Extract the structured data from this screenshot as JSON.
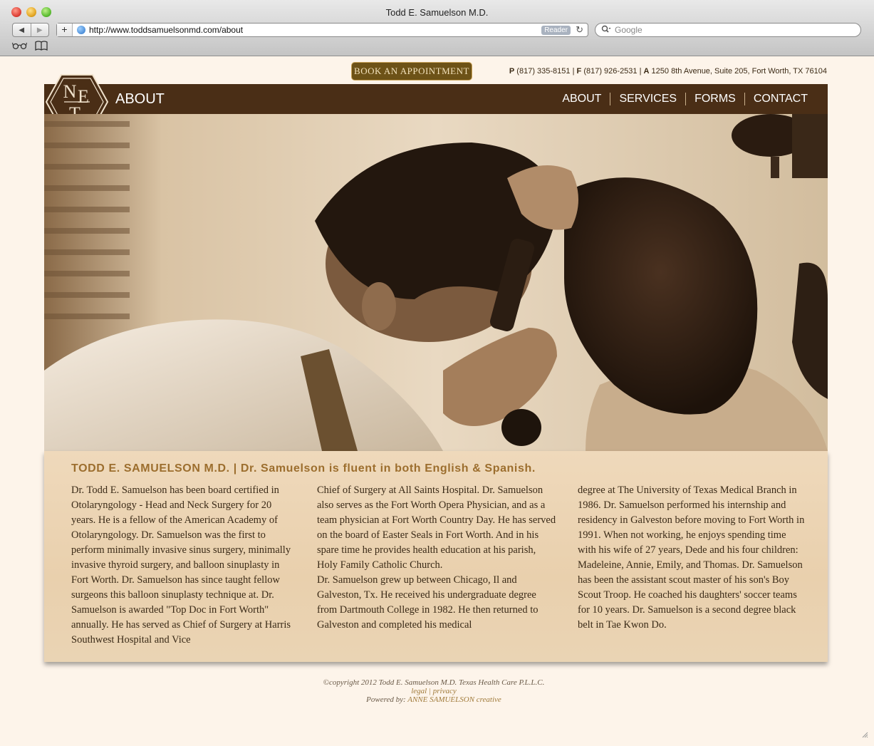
{
  "browser": {
    "window_title": "Todd E. Samuelson M.D.",
    "back_glyph": "◀",
    "forward_glyph": "▶",
    "add_glyph": "+",
    "url": "http://www.toddsamuelsonmd.com/about",
    "reader_label": "Reader",
    "reload_glyph": "↻",
    "search_placeholder": "Google",
    "bookmark_reading_glyph": "👓",
    "bookmark_book_glyph": "📖"
  },
  "topbar": {
    "book_button": "BOOK AN APPOINTMENT",
    "phone_label": "P",
    "phone": "(817) 335-8151",
    "fax_label": "F",
    "fax": "(817) 926-2531",
    "address_label": "A",
    "address": "1250 8th Avenue, Suite 205, Fort Worth, TX 76104"
  },
  "header": {
    "section_title": "ABOUT",
    "logo_letters": [
      "N",
      "E",
      "T"
    ],
    "nav": [
      "ABOUT",
      "SERVICES",
      "FORMS",
      "CONTACT"
    ]
  },
  "bio": {
    "heading": "TODD E. SAMUELSON M.D.  |  Dr. Samuelson is fluent in both English & Spanish.",
    "col1": "Dr. Todd E. Samuelson has been board certified in Otolaryngology - Head and Neck Surgery for 20 years. He is a fellow of the American Academy of Otolaryngology. Dr. Samuelson was the first to perform minimally invasive sinus surgery, minimally invasive thyroid surgery, and balloon sinuplasty in Fort Worth. Dr. Samuelson has since taught fellow surgeons this balloon sinuplasty technique at. Dr. Samuelson is awarded \"Top Doc in Fort Worth\" annually. He has served as Chief of Surgery at Harris Southwest Hospital and Vice",
    "col2a": "Chief of Surgery at All Saints Hospital. Dr. Samuelson also serves as the Fort Worth Opera Physician, and as a team physician at Fort Worth Country Day. He has served on the board of Easter Seals in Fort Worth. And in his spare time he provides health education at his parish, Holy Family Catholic Church.",
    "col2b": "Dr. Samuelson grew up between Chicago, Il and Galveston, Tx. He received his undergraduate degree from Dartmouth College in 1982. He then returned to Galveston and completed his medical",
    "col3": "degree at The University of Texas Medical Branch in 1986. Dr. Samuelson performed his internship and residency in Galveston before moving to Fort Worth in 1991. When not working, he enjoys spending time with his wife of 27 years, Dede and his four children: Madeleine, Annie, Emily, and Thomas. Dr. Samuelson has been the assistant scout master of his son's Boy Scout Troop. He coached his daughters' soccer teams for 10 years. Dr. Samuelson is a second degree black belt in Tae Kwon Do."
  },
  "footer": {
    "copyright": "©copyright 2012 Todd E. Samuelson M.D.   Texas Health Care P.L.L.C.",
    "legal": "legal",
    "divider": "|",
    "privacy": "privacy",
    "powered_label": "Powered by:",
    "powered_by": "ANNE SAMUELSON creative"
  }
}
